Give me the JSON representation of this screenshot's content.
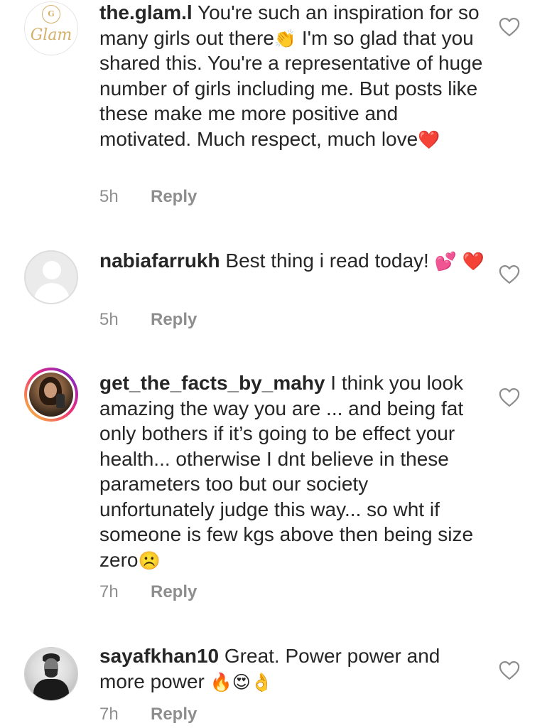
{
  "comments": [
    {
      "username": "the.glam.l",
      "text": "You're such an inspiration for so many girls out there",
      "emoji_1": "👏",
      "text_2": "I'm so glad that you shared this. You're a representative of huge number of girls including me. But posts like these make me more positive and motivated. Much respect, much love",
      "emoji_2": "❤️",
      "time": "5h",
      "reply_label": "Reply",
      "avatar_logo_mark": "G",
      "avatar_logo_text": "Glam"
    },
    {
      "username": "nabiafarrukh",
      "text": "Best thing i read today!",
      "emoji_1": "💕",
      "emoji_2": "❤️",
      "time": "5h",
      "reply_label": "Reply"
    },
    {
      "username": "get_the_facts_by_mahy",
      "text": "I think you look amazing the way you are ... and being fat only bothers if it’s going to be effect your health... otherwise I dnt believe in these parameters too but our society unfortunately judge this way... so wht if someone is few kgs above then being size zero",
      "emoji_1": "☹️",
      "time": "7h",
      "reply_label": "Reply"
    },
    {
      "username": "sayafkhan10",
      "text": "Great. Power power and more power",
      "emoji_1": "🔥",
      "emoji_2": "😍",
      "emoji_3": "👌",
      "time": "7h",
      "reply_label": "Reply"
    }
  ],
  "icons": {
    "like": "heart-outline-icon",
    "default_avatar": "default-avatar-icon"
  },
  "colors": {
    "text": "#262626",
    "secondary_text": "#8e8e8e",
    "heart_outline": "#8e8e8e",
    "story_ring_start": "#f9ce34",
    "story_ring_mid": "#ee2a7b",
    "story_ring_end": "#6228d7",
    "glam_gold": "#d4b06a"
  }
}
